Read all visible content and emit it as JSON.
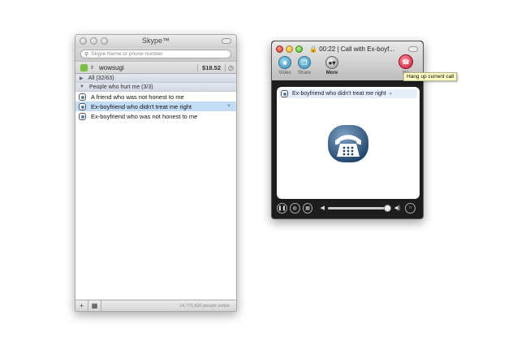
{
  "skype": {
    "title": "Skype™",
    "search_placeholder": "Skype Name or phone number",
    "username": "wowsugi",
    "credit": "$18.52",
    "groups": [
      {
        "label": "All (32/63)"
      },
      {
        "label": "People who hurt me (3/3)"
      }
    ],
    "contacts": [
      {
        "label": "A friend who was not honest to me"
      },
      {
        "label": "Ex-boyfriend who didn't treat me right"
      },
      {
        "label": "Ex-boyfriend who was not honest to me"
      }
    ],
    "online_count": "14,770,626 people online"
  },
  "call": {
    "title": "00:22 | Call with Ex-boyf...",
    "toolbar": {
      "video": "Video",
      "share": "Share",
      "more": "More",
      "hangup": "Ha"
    },
    "tooltip": "Hang up current call",
    "participant": "Ex-boyfriend who didn't treat me right",
    "volume": 1.0
  }
}
